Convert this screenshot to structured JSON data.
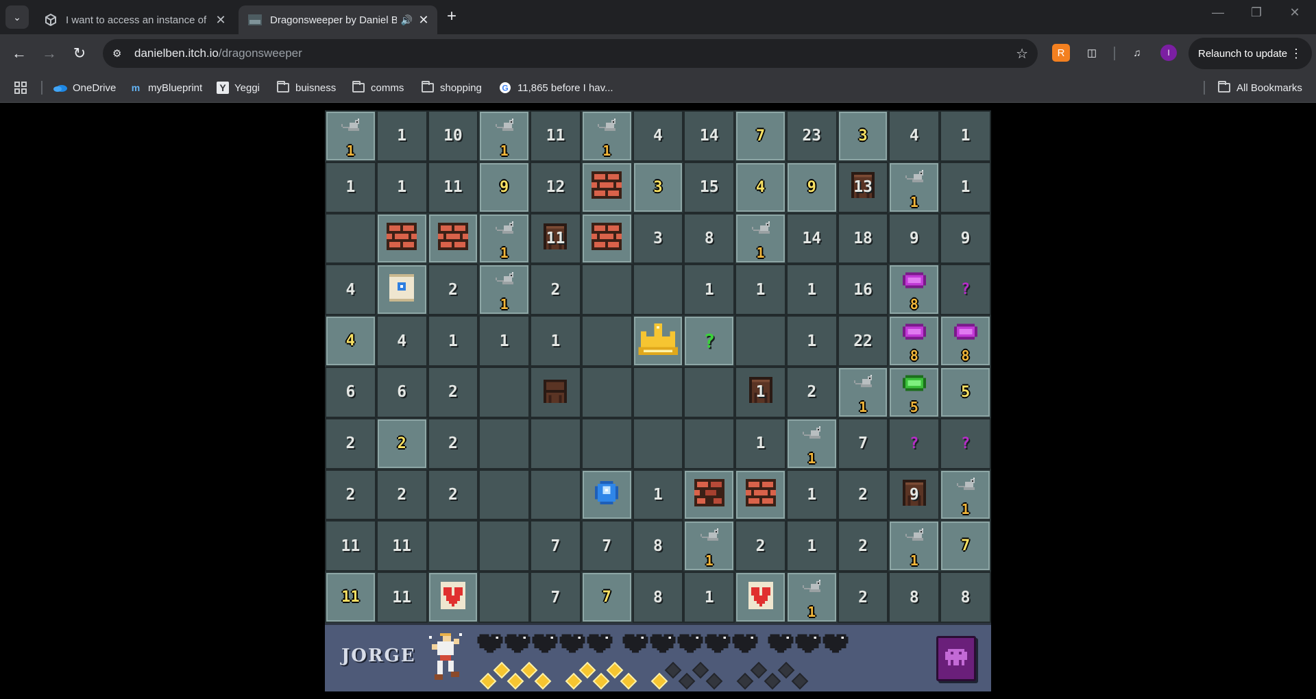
{
  "browser": {
    "tabs": [
      {
        "title": "I want to access an instance of a",
        "active": false
      },
      {
        "title": "Dragonsweeper by Daniel B",
        "active": true
      }
    ],
    "url_host": "danielben.itch.io",
    "url_path": "/dragonsweeper",
    "relaunch_label": "Relaunch to update",
    "profile_initial": "I"
  },
  "bookmarks": [
    {
      "label": "OneDrive",
      "icon": "onedrive-icon"
    },
    {
      "label": "myBlueprint",
      "icon": "myblueprint-icon"
    },
    {
      "label": "Yeggi",
      "icon": "yeggi-icon"
    },
    {
      "label": "buisness",
      "icon": "folder-icon"
    },
    {
      "label": "comms",
      "icon": "folder-icon"
    },
    {
      "label": "shopping",
      "icon": "folder-icon"
    },
    {
      "label": "11,865 before I hav...",
      "icon": "google-icon"
    }
  ],
  "all_bookmarks_label": "All Bookmarks",
  "game": {
    "player_name": "JORGE",
    "hearts_full": 13,
    "xp_full": 11,
    "xp_empty": 9,
    "colors": {
      "board": "#455658",
      "revealed": "#6a8485",
      "hud": "#4e5a78",
      "number_yellow": "#f7e063"
    },
    "grid": [
      [
        {
          "t": "rat",
          "n": "1"
        },
        {
          "t": "num",
          "n": "1"
        },
        {
          "t": "num",
          "n": "10"
        },
        {
          "t": "rat",
          "n": "1"
        },
        {
          "t": "num",
          "n": "11"
        },
        {
          "t": "rat",
          "n": "1"
        },
        {
          "t": "num",
          "n": "4"
        },
        {
          "t": "num",
          "n": "14"
        },
        {
          "t": "ynum",
          "n": "7"
        },
        {
          "t": "num",
          "n": "23"
        },
        {
          "t": "ynum",
          "n": "3"
        },
        {
          "t": "num",
          "n": "4"
        },
        {
          "t": "num",
          "n": "1"
        }
      ],
      [
        {
          "t": "num",
          "n": "1"
        },
        {
          "t": "num",
          "n": "1"
        },
        {
          "t": "num",
          "n": "11"
        },
        {
          "t": "ynum",
          "n": "9"
        },
        {
          "t": "num",
          "n": "12"
        },
        {
          "t": "wall",
          "n": ""
        },
        {
          "t": "ynum",
          "n": "3"
        },
        {
          "t": "num",
          "n": "15"
        },
        {
          "t": "ynum",
          "n": "4"
        },
        {
          "t": "ynum",
          "n": "9"
        },
        {
          "t": "door",
          "n": "13"
        },
        {
          "t": "rat",
          "n": "1"
        },
        {
          "t": "num",
          "n": "1"
        }
      ],
      [
        {
          "t": "empty",
          "n": ""
        },
        {
          "t": "wall",
          "n": ""
        },
        {
          "t": "wall",
          "n": ""
        },
        {
          "t": "rat",
          "n": "1"
        },
        {
          "t": "door",
          "n": "11"
        },
        {
          "t": "wall",
          "n": ""
        },
        {
          "t": "num",
          "n": "3"
        },
        {
          "t": "num",
          "n": "8"
        },
        {
          "t": "rat",
          "n": "1"
        },
        {
          "t": "num",
          "n": "14"
        },
        {
          "t": "num",
          "n": "18"
        },
        {
          "t": "num",
          "n": "9"
        },
        {
          "t": "num",
          "n": "9"
        }
      ],
      [
        {
          "t": "num",
          "n": "4"
        },
        {
          "t": "scroll",
          "n": ""
        },
        {
          "t": "num",
          "n": "2"
        },
        {
          "t": "rat",
          "n": "1"
        },
        {
          "t": "num",
          "n": "2"
        },
        {
          "t": "empty",
          "n": ""
        },
        {
          "t": "empty",
          "n": ""
        },
        {
          "t": "num",
          "n": "1"
        },
        {
          "t": "num",
          "n": "1"
        },
        {
          "t": "num",
          "n": "1"
        },
        {
          "t": "num",
          "n": "16"
        },
        {
          "t": "slime",
          "n": "8"
        },
        {
          "t": "mystery",
          "n": "?"
        }
      ],
      [
        {
          "t": "ynum",
          "n": "4"
        },
        {
          "t": "num",
          "n": "4"
        },
        {
          "t": "num",
          "n": "1"
        },
        {
          "t": "num",
          "n": "1"
        },
        {
          "t": "num",
          "n": "1"
        },
        {
          "t": "empty",
          "n": ""
        },
        {
          "t": "crown",
          "n": ""
        },
        {
          "t": "gmystery",
          "n": "?"
        },
        {
          "t": "empty",
          "n": ""
        },
        {
          "t": "num",
          "n": "1"
        },
        {
          "t": "num",
          "n": "22"
        },
        {
          "t": "slime",
          "n": "8"
        },
        {
          "t": "slime",
          "n": "8"
        }
      ],
      [
        {
          "t": "num",
          "n": "6"
        },
        {
          "t": "num",
          "n": "6"
        },
        {
          "t": "num",
          "n": "2"
        },
        {
          "t": "empty",
          "n": ""
        },
        {
          "t": "chest",
          "n": ""
        },
        {
          "t": "empty",
          "n": ""
        },
        {
          "t": "empty",
          "n": ""
        },
        {
          "t": "empty",
          "n": ""
        },
        {
          "t": "door",
          "n": "1"
        },
        {
          "t": "num",
          "n": "2"
        },
        {
          "t": "rat",
          "n": "1"
        },
        {
          "t": "gslime",
          "n": "5"
        },
        {
          "t": "ynum",
          "n": "5"
        }
      ],
      [
        {
          "t": "num",
          "n": "2"
        },
        {
          "t": "ynum",
          "n": "2"
        },
        {
          "t": "num",
          "n": "2"
        },
        {
          "t": "empty",
          "n": ""
        },
        {
          "t": "empty",
          "n": ""
        },
        {
          "t": "empty",
          "n": ""
        },
        {
          "t": "empty",
          "n": ""
        },
        {
          "t": "empty",
          "n": ""
        },
        {
          "t": "num",
          "n": "1"
        },
        {
          "t": "rat",
          "n": "1"
        },
        {
          "t": "num",
          "n": "7"
        },
        {
          "t": "mystery",
          "n": "?"
        },
        {
          "t": "mystery",
          "n": "?"
        }
      ],
      [
        {
          "t": "num",
          "n": "2"
        },
        {
          "t": "num",
          "n": "2"
        },
        {
          "t": "num",
          "n": "2"
        },
        {
          "t": "empty",
          "n": ""
        },
        {
          "t": "empty",
          "n": ""
        },
        {
          "t": "orb",
          "n": ""
        },
        {
          "t": "num",
          "n": "1"
        },
        {
          "t": "bwall",
          "n": ""
        },
        {
          "t": "wall",
          "n": ""
        },
        {
          "t": "num",
          "n": "1"
        },
        {
          "t": "num",
          "n": "2"
        },
        {
          "t": "door",
          "n": "9"
        },
        {
          "t": "rat",
          "n": "1"
        }
      ],
      [
        {
          "t": "num",
          "n": "11"
        },
        {
          "t": "num",
          "n": "11"
        },
        {
          "t": "empty",
          "n": ""
        },
        {
          "t": "empty",
          "n": ""
        },
        {
          "t": "num",
          "n": "7"
        },
        {
          "t": "num",
          "n": "7"
        },
        {
          "t": "num",
          "n": "8"
        },
        {
          "t": "rat",
          "n": "1"
        },
        {
          "t": "num",
          "n": "2"
        },
        {
          "t": "num",
          "n": "1"
        },
        {
          "t": "num",
          "n": "2"
        },
        {
          "t": "rat",
          "n": "1"
        },
        {
          "t": "ynum",
          "n": "7"
        }
      ],
      [
        {
          "t": "ynum",
          "n": "11"
        },
        {
          "t": "num",
          "n": "11"
        },
        {
          "t": "heart",
          "n": ""
        },
        {
          "t": "empty",
          "n": ""
        },
        {
          "t": "num",
          "n": "7"
        },
        {
          "t": "ynum",
          "n": "7"
        },
        {
          "t": "num",
          "n": "8"
        },
        {
          "t": "num",
          "n": "1"
        },
        {
          "t": "heart",
          "n": ""
        },
        {
          "t": "rat",
          "n": "1"
        },
        {
          "t": "num",
          "n": "2"
        },
        {
          "t": "num",
          "n": "8"
        },
        {
          "t": "num",
          "n": "8"
        }
      ]
    ]
  }
}
